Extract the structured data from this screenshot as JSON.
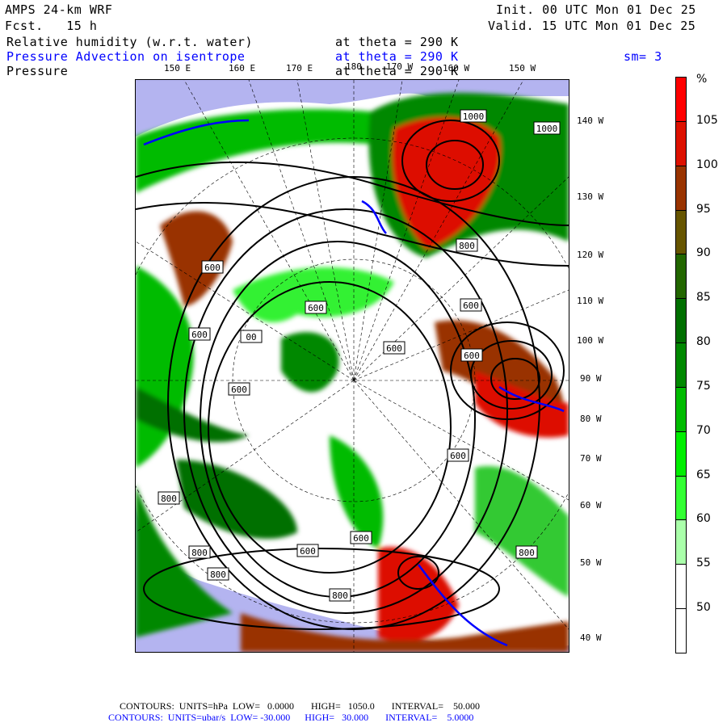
{
  "header": {
    "model": "AMPS 24-km WRF",
    "fcst": "Fcst.   15 h",
    "init": "Init. 00 UTC Mon 01 Dec 25",
    "valid": "Valid. 15 UTC Mon 01 Dec 25",
    "field1": "Relative humidity (w.r.t. water)",
    "field1_level": "at theta = 290 K",
    "field2": "Pressure Advection on isentrope",
    "field2_level": "at theta = 290 K",
    "smoothing": "sm= 3",
    "field3": "Pressure",
    "field3_level": "at theta = 290 K"
  },
  "lon_labels": [
    "150 E",
    "160 E",
    "170 E",
    "180",
    "170 W",
    "160 W",
    "150 W"
  ],
  "lat_labels": [
    "140 W",
    "130 W",
    "120 W",
    "110 W",
    "100 W",
    "90 W",
    "80 W",
    "70 W",
    "60 W",
    "50 W",
    "40 W"
  ],
  "contour_labels": [
    "1000",
    "1000",
    "800",
    "600",
    "600",
    "600",
    "600",
    "00",
    "600",
    "600",
    "600",
    "600",
    "800",
    "600",
    "600",
    "800",
    "800",
    "800",
    "800"
  ],
  "colorbar": {
    "unit": "%",
    "labels": [
      "105",
      "100",
      "95",
      "90",
      "85",
      "80",
      "75",
      "70",
      "65",
      "60",
      "55",
      "50"
    ],
    "colors": [
      "#ff0000",
      "#dd1100",
      "#993300",
      "#665500",
      "#226600",
      "#006f00",
      "#008800",
      "#00bb00",
      "#00ee00",
      "#33ff33",
      "#aaffaa",
      "#ffffff",
      "#ffffff"
    ]
  },
  "footer": {
    "line1": "CONTOURS:  UNITS=hPa  LOW=   0.0000       HIGH=   1050.0       INTERVAL=    50.000",
    "line2": "CONTOURS:  UNITS=ubar/s  LOW= -30.000      HIGH=   30.000       INTERVAL=    5.0000"
  }
}
